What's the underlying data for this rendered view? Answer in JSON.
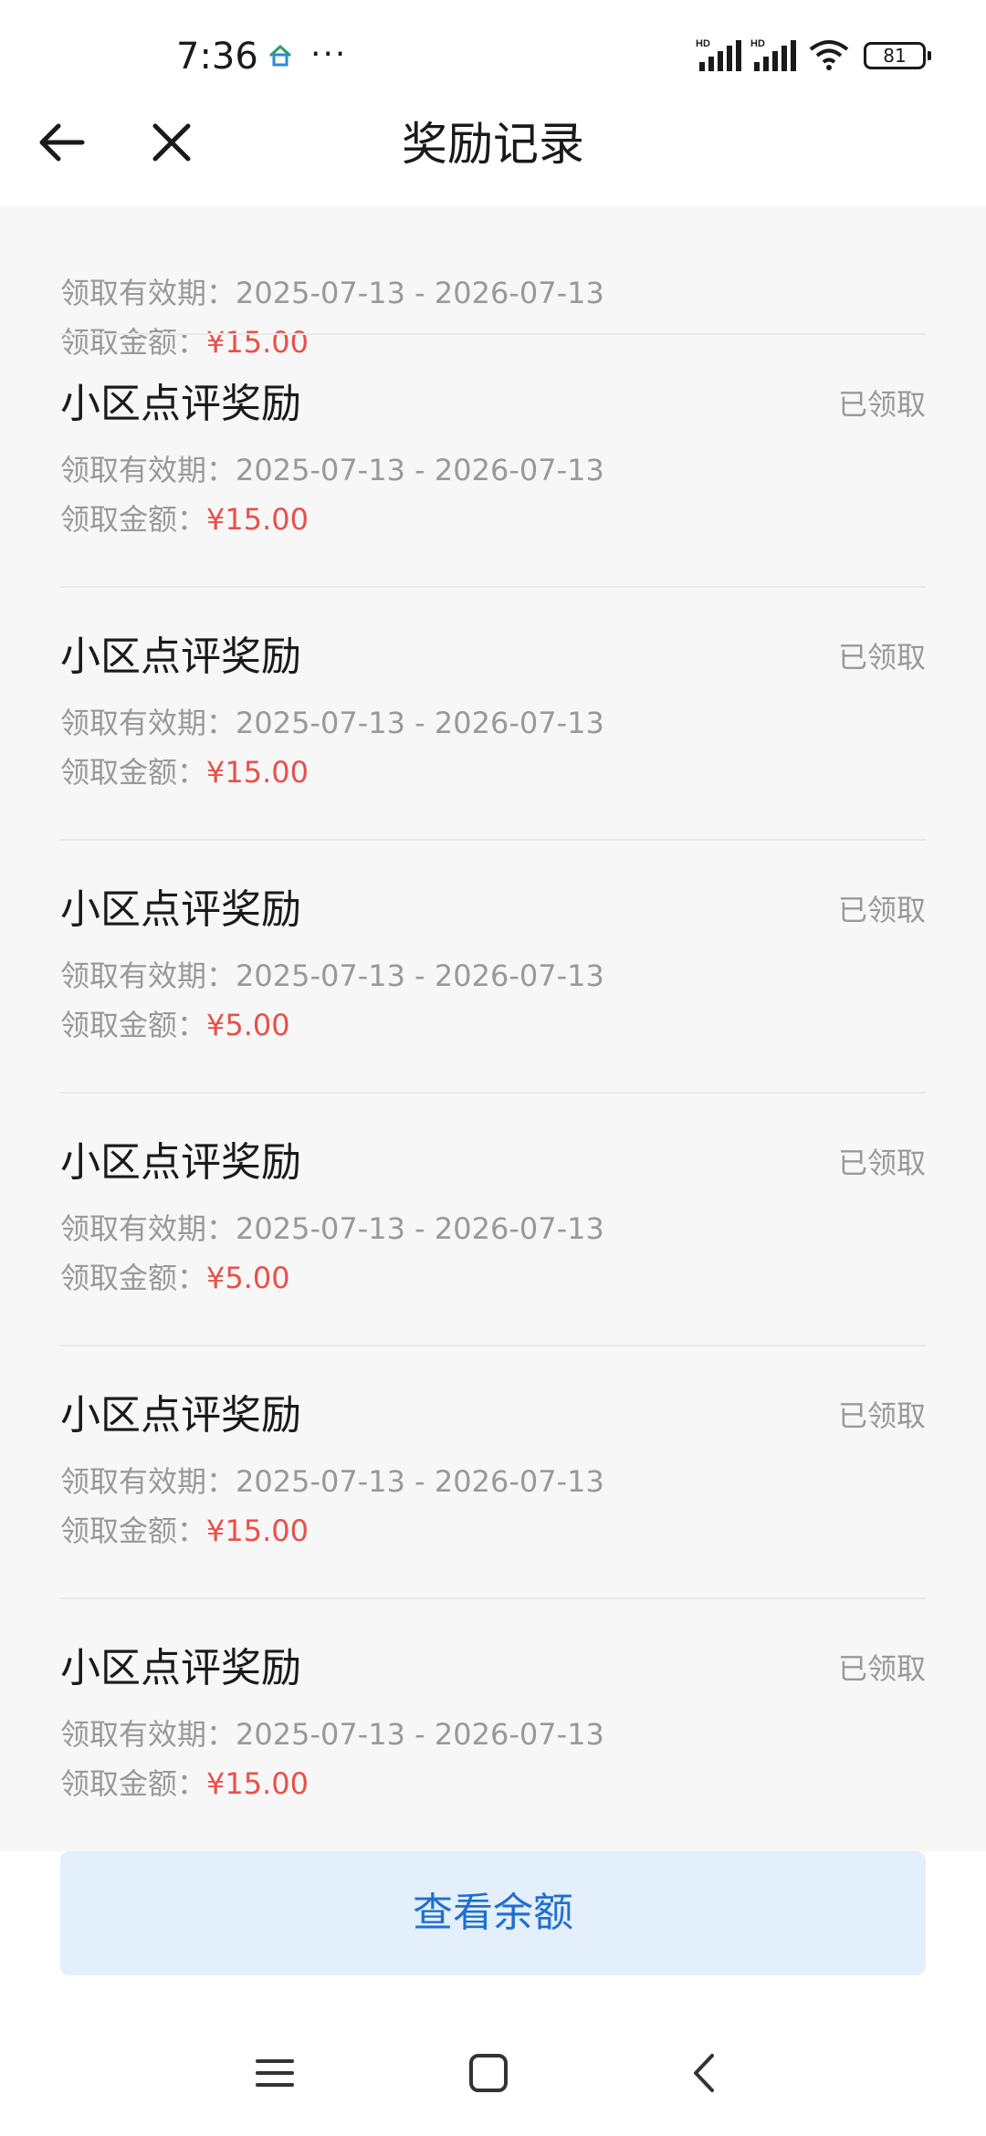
{
  "status_bar": {
    "time": "7:36",
    "dots": "···",
    "battery": "81",
    "network_label": "HD"
  },
  "header": {
    "title": "奖励记录"
  },
  "partial_record": {
    "validity_label": "领取有效期：",
    "validity": "2025-07-13 - 2026-07-13",
    "amount_label": "领取金额：",
    "amount": "¥15.00"
  },
  "records": [
    {
      "title": "小区点评奖励",
      "status": "已领取",
      "validity_label": "领取有效期：",
      "validity": "2025-07-13 - 2026-07-13",
      "amount_label": "领取金额：",
      "amount": "¥15.00"
    },
    {
      "title": "小区点评奖励",
      "status": "已领取",
      "validity_label": "领取有效期：",
      "validity": "2025-07-13 - 2026-07-13",
      "amount_label": "领取金额：",
      "amount": "¥15.00"
    },
    {
      "title": "小区点评奖励",
      "status": "已领取",
      "validity_label": "领取有效期：",
      "validity": "2025-07-13 - 2026-07-13",
      "amount_label": "领取金额：",
      "amount": "¥5.00"
    },
    {
      "title": "小区点评奖励",
      "status": "已领取",
      "validity_label": "领取有效期：",
      "validity": "2025-07-13 - 2026-07-13",
      "amount_label": "领取金额：",
      "amount": "¥5.00"
    },
    {
      "title": "小区点评奖励",
      "status": "已领取",
      "validity_label": "领取有效期：",
      "validity": "2025-07-13 - 2026-07-13",
      "amount_label": "领取金额：",
      "amount": "¥15.00"
    },
    {
      "title": "小区点评奖励",
      "status": "已领取",
      "validity_label": "领取有效期：",
      "validity": "2025-07-13 - 2026-07-13",
      "amount_label": "领取金额：",
      "amount": "¥15.00"
    }
  ],
  "bottom": {
    "balance_button": "查看余额"
  },
  "colors": {
    "accent": "#1f6fd1",
    "amount": "#e8504a",
    "muted": "#999999",
    "button_bg": "#e3effb"
  }
}
